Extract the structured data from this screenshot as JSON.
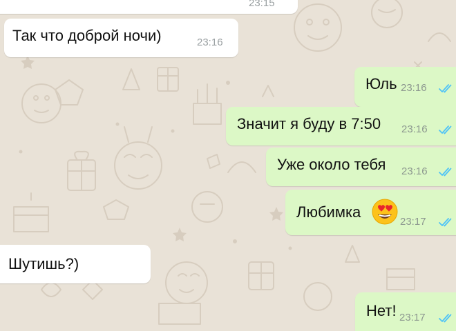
{
  "chat": {
    "theme": {
      "incoming_bg": "#ffffff",
      "outgoing_bg": "#dcf8c6",
      "wallpaper_bg": "#e9e2d7",
      "read_tick_color": "#4fc3f7"
    },
    "messages": [
      {
        "direction": "incoming",
        "text": "",
        "time": "23:15"
      },
      {
        "direction": "incoming",
        "text": "Так что доброй ночи)",
        "time": "23:16"
      },
      {
        "direction": "outgoing",
        "text": "Юль",
        "time": "23:16",
        "status": "read-double-check-icon"
      },
      {
        "direction": "outgoing",
        "text": "Значит я буду в 7:50",
        "time": "23:16",
        "status": "read-double-check-icon"
      },
      {
        "direction": "outgoing",
        "text": "Уже около тебя",
        "time": "23:16",
        "status": "read-double-check-icon"
      },
      {
        "direction": "outgoing",
        "text": "Любимка",
        "emoji": "heart-eyes-emoji",
        "time": "23:17",
        "status": "read-double-check-icon"
      },
      {
        "direction": "incoming",
        "text": "Шутишь?)",
        "time": ""
      },
      {
        "direction": "outgoing",
        "text": "Нет!",
        "time": "23:17",
        "status": "read-double-check-icon"
      }
    ]
  }
}
